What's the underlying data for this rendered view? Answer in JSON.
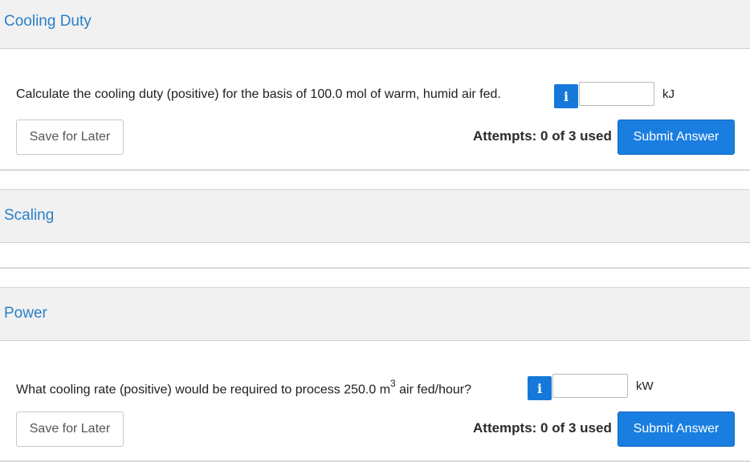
{
  "sections": [
    {
      "title": "Cooling Duty"
    },
    {
      "title": "Scaling"
    },
    {
      "title": "Power"
    }
  ],
  "questions": [
    {
      "prompt": "Calculate the cooling duty (positive) for the basis of 100.0 mol of warm, humid air fed.",
      "input_value": "",
      "unit": "kJ",
      "save_label": "Save for Later",
      "attempts": "Attempts: 0 of 3 used",
      "submit_label": "Submit Answer",
      "info_glyph": "i"
    },
    {
      "prompt_before": "What cooling rate (positive) would be required to process 250.0 m",
      "prompt_sup": "3",
      "prompt_after": " air fed/hour?",
      "input_value": "",
      "unit": "kW",
      "save_label": "Save for Later",
      "attempts": "Attempts: 0 of 3 used",
      "submit_label": "Submit Answer",
      "info_glyph": "i"
    }
  ]
}
